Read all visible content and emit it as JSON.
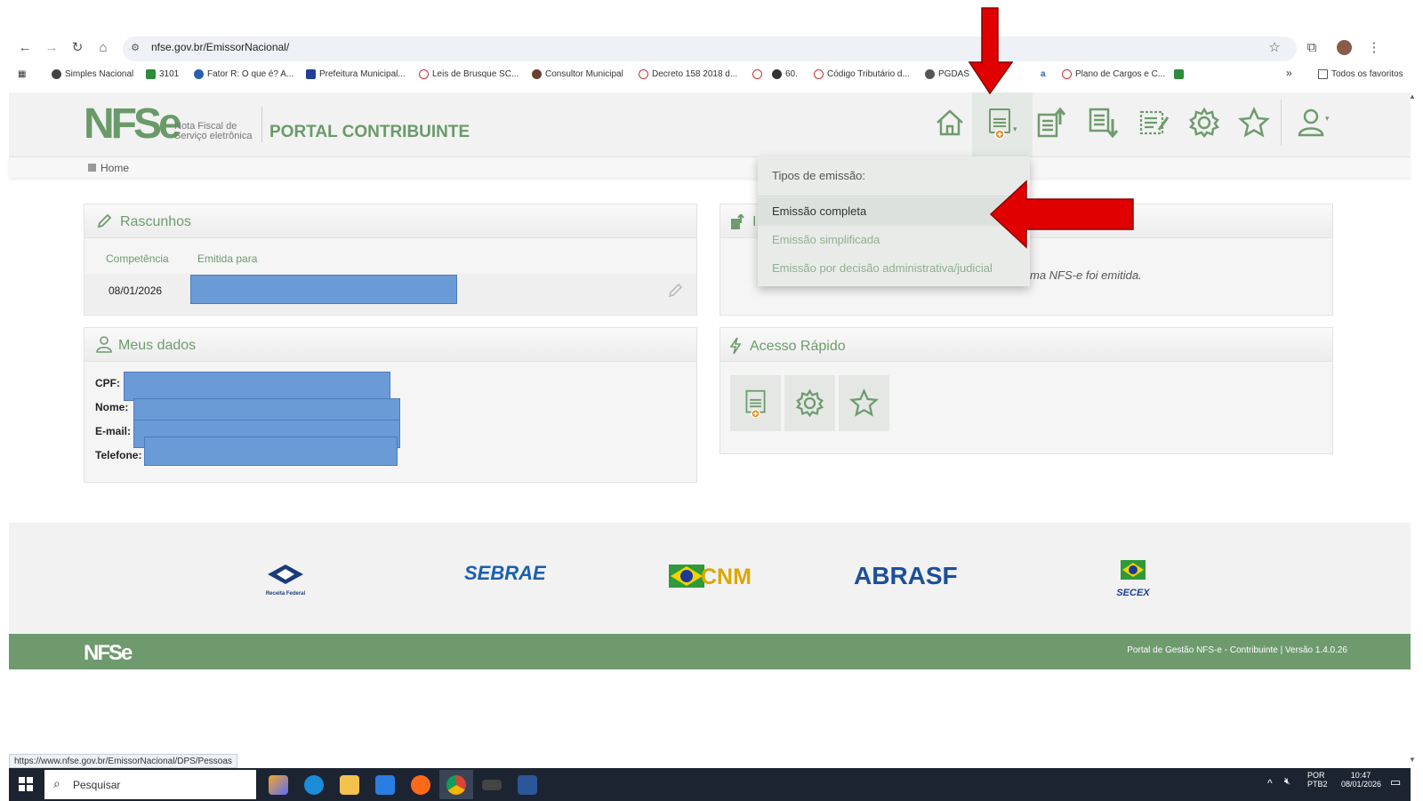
{
  "browser": {
    "url": "nfse.gov.br/EmissorNacional/",
    "bookmarks": [
      "Simples Nacional",
      "3101",
      "Fator R: O que é? A...",
      "Prefeitura Municipal...",
      "Leis de Brusque SC...",
      "Consultor Municipal",
      "Decreto 158 2018 d...",
      "60.",
      "Código Tributário d...",
      "PGDAS",
      "Plano de Cargos e C..."
    ],
    "all_favorites": "Todos os favoritos",
    "overflow": "»"
  },
  "header": {
    "logo": "NFSe",
    "logo_sub_1": "Nota Fiscal de",
    "logo_sub_2": "Serviço eletrônica",
    "title": "PORTAL CONTRIBUINTE",
    "icons": [
      "home-icon",
      "emit-nfse-icon",
      "issued-nfse-icon",
      "received-nfse-icon",
      "edit-document-icon",
      "settings-icon",
      "favorites-icon",
      "user-icon"
    ]
  },
  "breadcrumb": {
    "home": "Home"
  },
  "dropdown": {
    "heading": "Tipos de emissão:",
    "items": [
      "Emissão completa",
      "Emissão simplificada",
      "Emissão por decisão administrativa/judicial"
    ]
  },
  "rascunhos": {
    "title": "Rascunhos",
    "col_competencia": "Competência",
    "col_emitida_para": "Emitida para",
    "row_date": "08/01/2026"
  },
  "emitidas": {
    "partial_title": "I",
    "partial_message": "ma NFS-e foi emitida."
  },
  "meus_dados": {
    "title": "Meus dados",
    "cpf_label": "CPF:",
    "nome_label": "Nome:",
    "email_label": "E-mail:",
    "telefone_label": "Telefone:"
  },
  "acesso_rapido": {
    "title": "Acesso Rápido",
    "tiles": [
      "emit-nfse-icon",
      "settings-icon",
      "favorites-icon"
    ]
  },
  "footer": {
    "logos": [
      "Receita Federal",
      "SEBRAE",
      "CNM",
      "ABRASF",
      "SECEX"
    ],
    "brand": "NFSe",
    "version": "Portal de Gestão NFS-e - Contribuinte | Versão 1.4.0.26"
  },
  "status_url": "https://www.nfse.gov.br/EmissorNacional/DPS/Pessoas",
  "taskbar": {
    "search": "Pesquisar",
    "lang_1": "POR",
    "lang_2": "PTB2",
    "time": "10:47",
    "date": "08/01/2026"
  },
  "colors": {
    "brand_green": "#6f9b6f",
    "redaction_blue": "#6b9bd6",
    "annotation_red": "#e00000"
  }
}
